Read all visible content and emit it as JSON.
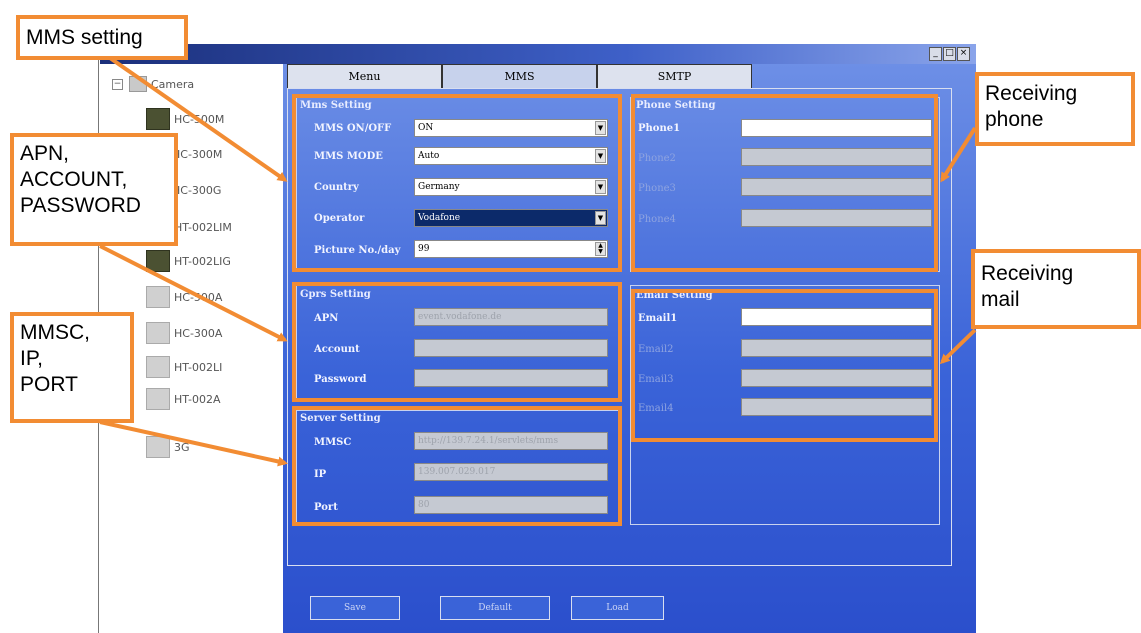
{
  "window": {
    "controls": [
      "_",
      "□",
      "×"
    ]
  },
  "tree": {
    "root": "Camera",
    "collapse_symbol": "−",
    "items": [
      "HC-500M",
      "HC-300M",
      "HC-300G",
      "HT-002LIM",
      "HT-002LIG",
      "HC-500A",
      "HC-300A",
      "HT-002LI",
      "HT-002A",
      "3G"
    ]
  },
  "tabs": [
    "Menu",
    "MMS",
    "SMTP"
  ],
  "mms_setting": {
    "title": "Mms Setting",
    "rows": [
      {
        "label": "MMS ON/OFF",
        "value": "ON"
      },
      {
        "label": "MMS MODE",
        "value": "Auto"
      },
      {
        "label": "Country",
        "value": "Germany"
      },
      {
        "label": "Operator",
        "value": "Vodafone"
      },
      {
        "label": "Picture No./day",
        "value": "99"
      }
    ]
  },
  "gprs_setting": {
    "title": "Gprs Setting",
    "rows": [
      {
        "label": "APN",
        "value": "event.vodafone.de"
      },
      {
        "label": "Account",
        "value": ""
      },
      {
        "label": "Password",
        "value": ""
      }
    ]
  },
  "server_setting": {
    "title": "Server Setting",
    "rows": [
      {
        "label": "MMSC",
        "value": "http://139.7.24.1/servlets/mms"
      },
      {
        "label": "IP",
        "value": "139.007.029.017"
      },
      {
        "label": "Port",
        "value": "80"
      }
    ]
  },
  "phone_setting": {
    "title": "Phone Setting",
    "rows": [
      "Phone1",
      "Phone2",
      "Phone3",
      "Phone4"
    ]
  },
  "email_setting": {
    "title": "Email Setting",
    "rows": [
      "Email1",
      "Email2",
      "Email3",
      "Email4"
    ]
  },
  "buttons": [
    "Save",
    "Default",
    "Load"
  ],
  "annotations": {
    "mms_setting": "MMS setting",
    "apn": [
      "APN,",
      "ACCOUNT,",
      "PASSWORD"
    ],
    "mmsc": [
      "MMSC,",
      "IP,",
      "PORT"
    ],
    "receiving_phone": [
      "Receiving",
      "phone"
    ],
    "receiving_mail": [
      "Receiving",
      "mail"
    ]
  },
  "colors": {
    "annotation": "#f28c33",
    "panel": "#3a63d8",
    "titlebar": "#1b2f7a"
  }
}
